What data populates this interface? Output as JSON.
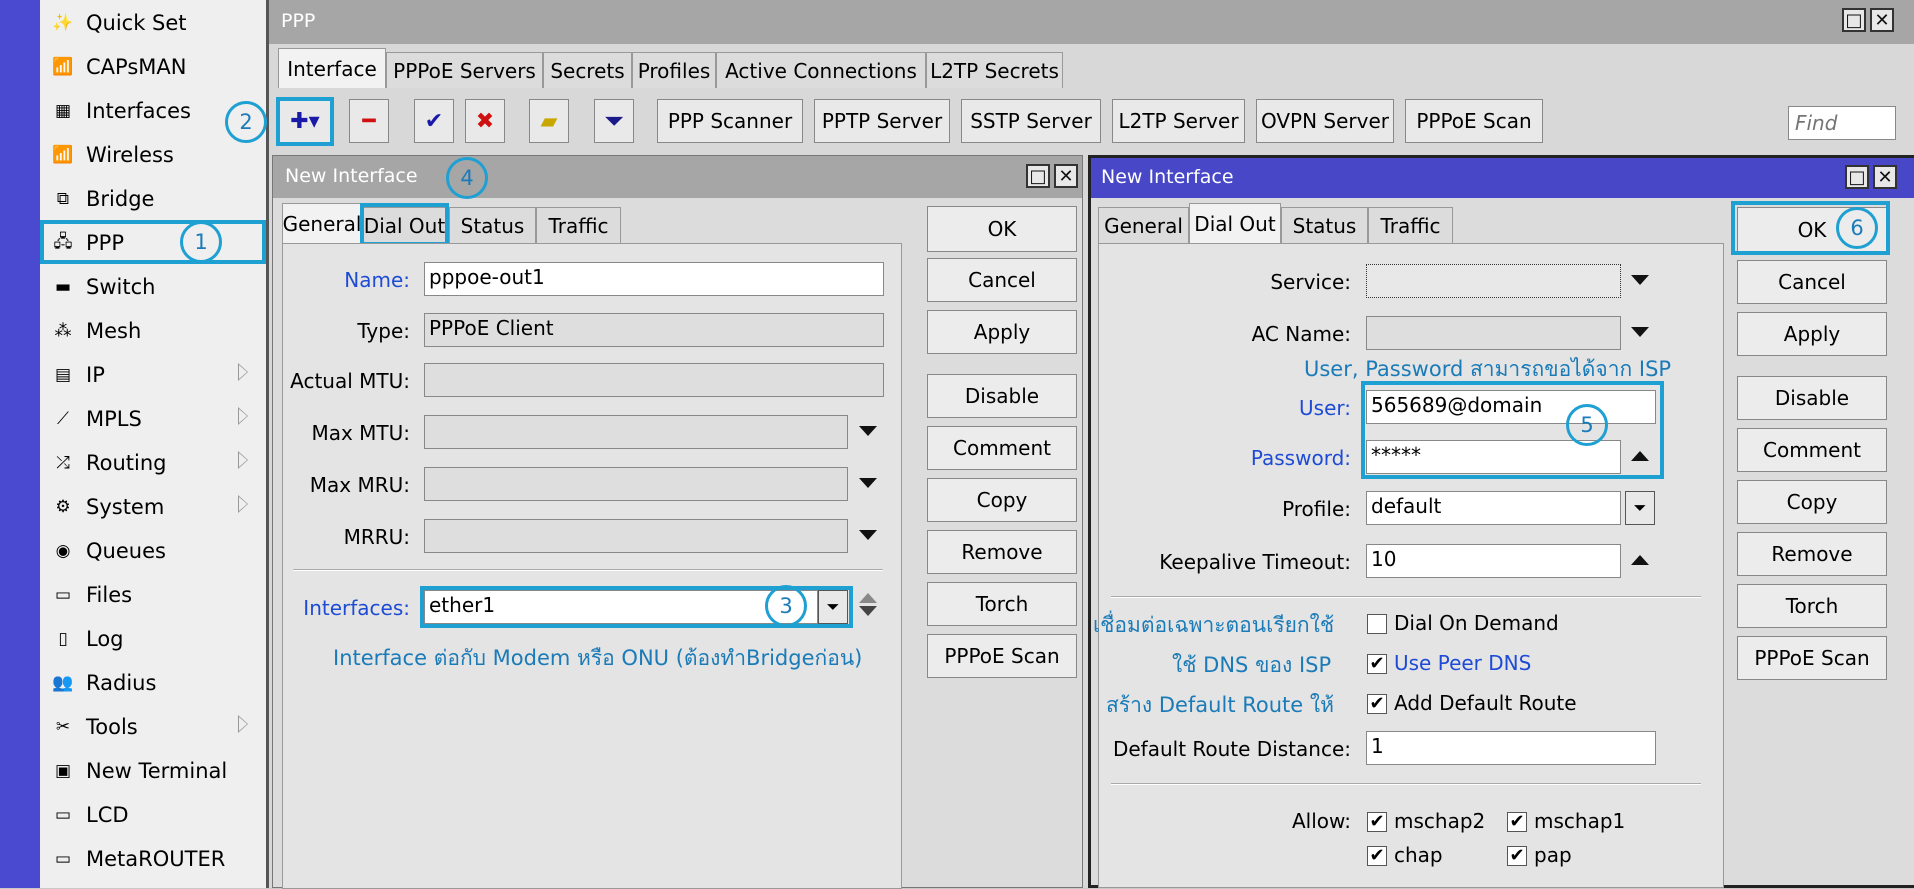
{
  "sidebar": {
    "items": [
      {
        "label": "Quick Set",
        "icon": "wand-icon"
      },
      {
        "label": "CAPsMAN",
        "icon": "antenna-icon"
      },
      {
        "label": "Interfaces",
        "icon": "interfaces-icon"
      },
      {
        "label": "Wireless",
        "icon": "antenna-icon"
      },
      {
        "label": "Bridge",
        "icon": "bridge-icon"
      },
      {
        "label": "PPP",
        "icon": "ppp-icon"
      },
      {
        "label": "Switch",
        "icon": "switch-icon"
      },
      {
        "label": "Mesh",
        "icon": "mesh-icon"
      },
      {
        "label": "IP",
        "icon": "ip-icon"
      },
      {
        "label": "MPLS",
        "icon": "mpls-icon"
      },
      {
        "label": "Routing",
        "icon": "routing-icon"
      },
      {
        "label": "System",
        "icon": "gear-icon"
      },
      {
        "label": "Queues",
        "icon": "queues-icon"
      },
      {
        "label": "Files",
        "icon": "folder-icon"
      },
      {
        "label": "Log",
        "icon": "log-icon"
      },
      {
        "label": "Radius",
        "icon": "users-icon"
      },
      {
        "label": "Tools",
        "icon": "tools-icon"
      },
      {
        "label": "New Terminal",
        "icon": "terminal-icon"
      },
      {
        "label": "LCD",
        "icon": "monitor-icon"
      },
      {
        "label": "MetaROUTER",
        "icon": "monitor-icon"
      }
    ]
  },
  "ppp_window": {
    "title": "PPP",
    "tabs": [
      "Interface",
      "PPPoE Servers",
      "Secrets",
      "Profiles",
      "Active Connections",
      "L2TP Secrets"
    ],
    "toolbar_buttons": [
      "PPP Scanner",
      "PPTP Server",
      "SSTP Server",
      "L2TP Server",
      "OVPN Server",
      "PPPoE Scan"
    ],
    "find_placeholder": "Find"
  },
  "left_dialog": {
    "title": "New Interface",
    "tabs": [
      "General",
      "Dial Out",
      "Status",
      "Traffic"
    ],
    "name_label": "Name:",
    "name_value": "pppoe-out1",
    "type_label": "Type:",
    "type_value": "PPPoE Client",
    "actual_mtu_label": "Actual MTU:",
    "max_mtu_label": "Max MTU:",
    "max_mru_label": "Max MRU:",
    "mrru_label": "MRRU:",
    "interfaces_label": "Interfaces:",
    "interfaces_value": "ether1",
    "note": "Interface ต่อกับ Modem หรือ ONU (ต้องทำBridgeก่อน)",
    "buttons": [
      "OK",
      "Cancel",
      "Apply",
      "Disable",
      "Comment",
      "Copy",
      "Remove",
      "Torch",
      "PPPoE Scan"
    ]
  },
  "right_dialog": {
    "title": "New Interface",
    "tabs": [
      "General",
      "Dial Out",
      "Status",
      "Traffic"
    ],
    "service_label": "Service:",
    "ac_name_label": "AC Name:",
    "isp_note": "User, Password สามารถขอได้จาก ISP",
    "user_label": "User:",
    "user_value": "565689@domain",
    "password_label": "Password:",
    "password_value": "*****",
    "profile_label": "Profile:",
    "profile_value": "default",
    "keepalive_label": "Keepalive Timeout:",
    "keepalive_value": "10",
    "dial_on_demand_note": "เชื่อมต่อเฉพาะตอนเรียกใช้",
    "dial_on_demand_label": "Dial On Demand",
    "peer_dns_note": "ใช้ DNS ของ ISP",
    "peer_dns_label": "Use Peer DNS",
    "default_route_note": "สร้าง Default Route ให้",
    "default_route_label": "Add Default Route",
    "distance_label": "Default Route Distance:",
    "distance_value": "1",
    "allow_label": "Allow:",
    "allow_options": [
      "mschap2",
      "mschap1",
      "chap",
      "pap"
    ],
    "buttons": [
      "OK",
      "Cancel",
      "Apply",
      "Disable",
      "Comment",
      "Copy",
      "Remove",
      "Torch",
      "PPPoE Scan"
    ]
  },
  "annotations": [
    "1",
    "2",
    "3",
    "4",
    "5",
    "6"
  ],
  "colors": {
    "accent": "#1fa0d2",
    "sidebar_strip": "#4a4ad0",
    "link_blue": "#1e4bd6"
  }
}
